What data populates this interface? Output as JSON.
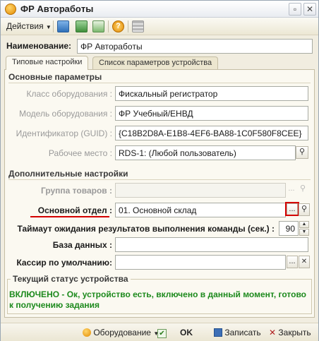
{
  "window": {
    "title": "ФР Авторабoты"
  },
  "toolbar": {
    "actions_label": "Действия"
  },
  "name_field": {
    "label": "Наименование:",
    "value": "ФР Авторабoты"
  },
  "tabs": [
    {
      "label": "Типовые настройки"
    },
    {
      "label": "Список параметров устройства"
    }
  ],
  "main_params": {
    "title": "Основные параметры",
    "equipment_class": {
      "label": "Класс оборудования :",
      "value": "Фискальный регистратор"
    },
    "equipment_model": {
      "label": "Модель оборудования :",
      "value": "ФР Учебный/ЕНВД"
    },
    "identifier": {
      "label": "Идентификатор (GUID) :",
      "value": "{C18B2D8A-E1B8-4EF6-BA88-1C0F580F8CEE}"
    },
    "workplace": {
      "label": "Рабочее место :",
      "value": "RDS-1: (Любой пользователь)"
    }
  },
  "extra_settings": {
    "title": "Дополнительные настройки",
    "product_group": {
      "label": "Группа товаров :",
      "value": ""
    },
    "main_department": {
      "label": "Основной отдел :",
      "value": "01.  Основной склад"
    },
    "timeout": {
      "label": "Таймаут ожидания результатов выполнения команды (сек.) :",
      "value": "90"
    },
    "database": {
      "label": "База данных :",
      "value": ""
    },
    "default_cashier": {
      "label": "Кассир по умолчанию:",
      "value": ""
    }
  },
  "status": {
    "title": "Текущий статус устройства",
    "text": "ВКЛЮЧЕНО - Ок, устройство есть, включено в данный момент, готово к получению задания"
  },
  "footer": {
    "equipment_label": "Оборудование",
    "ok_label": "OK",
    "save_label": "Записать",
    "close_label": "Закрыть"
  },
  "colors": {
    "status_green": "#1d8a1d",
    "highlight_red": "#d40000"
  }
}
